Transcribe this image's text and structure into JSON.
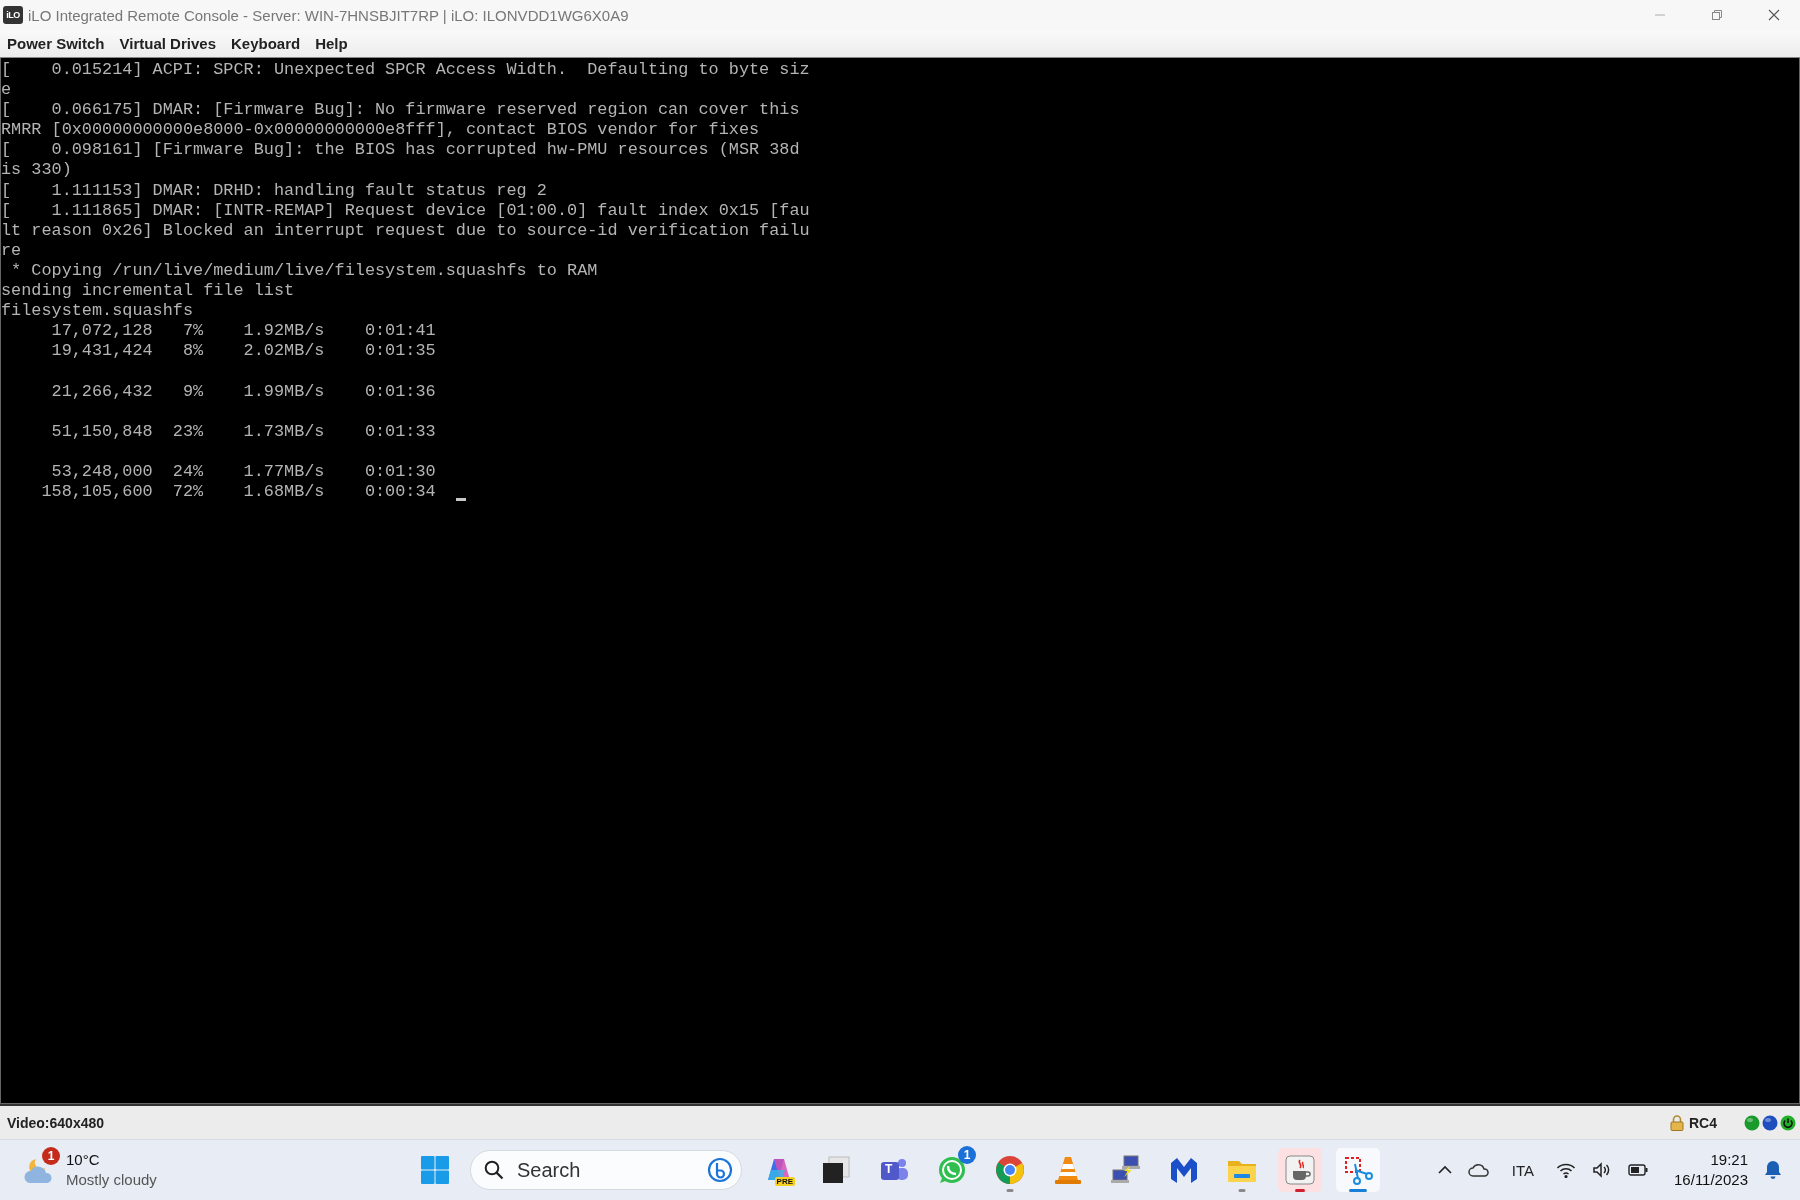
{
  "window": {
    "logo": "iLO",
    "title": "iLO Integrated Remote Console - Server: WIN-7HNSBJIT7RP | iLO: ILONVDD1WG6X0A9"
  },
  "menu": [
    "Power Switch",
    "Virtual Drives",
    "Keyboard",
    "Help"
  ],
  "terminal": {
    "cursor": true,
    "lines": [
      {
        "kind": "text",
        "text": "[    0.015214] ACPI: SPCR: Unexpected SPCR Access Width.  Defaulting to byte siz"
      },
      {
        "kind": "text",
        "text": "e"
      },
      {
        "kind": "text",
        "text": "[    0.066175] DMAR: [Firmware Bug]: No firmware reserved region can cover this"
      },
      {
        "kind": "text",
        "text": "RMRR [0x00000000000e8000-0x00000000000e8fff], contact BIOS vendor for fixes"
      },
      {
        "kind": "text",
        "text": "[    0.098161] [Firmware Bug]: the BIOS has corrupted hw-PMU resources (MSR 38d"
      },
      {
        "kind": "text",
        "text": "is 330)"
      },
      {
        "kind": "text",
        "text": "[    1.111153] DMAR: DRHD: handling fault status reg 2"
      },
      {
        "kind": "text",
        "text": "[    1.111865] DMAR: [INTR-REMAP] Request device [01:00.0] fault index 0x15 [fau"
      },
      {
        "kind": "text",
        "text": "lt reason 0x26] Blocked an interrupt request due to source-id verification failu"
      },
      {
        "kind": "text",
        "text": "re"
      },
      {
        "kind": "text",
        "text": " * Copying /run/live/medium/live/filesystem.squashfs to RAM"
      },
      {
        "kind": "text",
        "text": "sending incremental file list"
      },
      {
        "kind": "text",
        "text": "filesystem.squashfs"
      },
      {
        "kind": "text",
        "text": "     17,072,128   7%    1.92MB/s    0:01:41"
      },
      {
        "kind": "text",
        "text": "     19,431,424   8%    2.02MB/s    0:01:35"
      },
      {
        "kind": "blank"
      },
      {
        "kind": "text",
        "text": "     21,266,432   9%    1.99MB/s    0:01:36"
      },
      {
        "kind": "blank"
      },
      {
        "kind": "text",
        "text": "     51,150,848  23%    1.73MB/s    0:01:33"
      },
      {
        "kind": "blank"
      },
      {
        "kind": "text",
        "text": "     53,248,000  24%    1.77MB/s    0:01:30"
      },
      {
        "kind": "text",
        "text": "    158,105,600  72%    1.68MB/s    0:00:34"
      }
    ]
  },
  "status_bar": {
    "video": "Video:640x480",
    "encryption": "RC4",
    "lights": [
      {
        "kind": "dot",
        "color": "#1a9a2a"
      },
      {
        "kind": "dot",
        "color": "#1f4fbf"
      },
      {
        "kind": "power",
        "color": "#22b02a"
      }
    ]
  },
  "taskbar": {
    "weather": {
      "badge": "1",
      "temperature": "10°C",
      "condition": "Mostly cloudy"
    },
    "search": {
      "placeholder": "Search"
    },
    "apps": [
      {
        "kind": "copilot",
        "label": "PRE",
        "running": false,
        "flashing": false,
        "active": false
      },
      {
        "kind": "squares",
        "running": false,
        "flashing": false,
        "active": false
      },
      {
        "kind": "teams",
        "label": "T",
        "running": false,
        "flashing": false,
        "active": false
      },
      {
        "kind": "whatsapp",
        "badge": "1",
        "running": false,
        "flashing": false,
        "active": false
      },
      {
        "kind": "chrome",
        "running": true,
        "flashing": false,
        "active": false
      },
      {
        "kind": "cone",
        "running": false,
        "flashing": false,
        "active": false
      },
      {
        "kind": "network",
        "running": false,
        "flashing": false,
        "active": false
      },
      {
        "kind": "shield",
        "running": false,
        "flashing": false,
        "active": false
      },
      {
        "kind": "folder",
        "running": true,
        "flashing": false,
        "active": false
      },
      {
        "kind": "java",
        "running": true,
        "flashing": true,
        "active": false
      },
      {
        "kind": "snip",
        "running": true,
        "flashing": false,
        "active": true
      }
    ],
    "tray": {
      "language": "ITA",
      "time": "19:21",
      "date": "16/11/2023"
    }
  }
}
